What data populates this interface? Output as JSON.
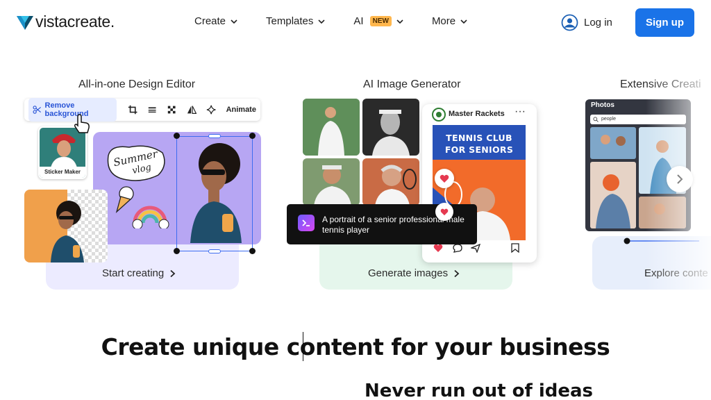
{
  "header": {
    "logo_prefix": "vista",
    "logo_suffix": "create",
    "logo_dot": ".",
    "nav": [
      {
        "label": "Create"
      },
      {
        "label": "Templates"
      },
      {
        "label": "AI",
        "badge": "NEW"
      },
      {
        "label": "More"
      }
    ],
    "login_label": "Log in",
    "signup_label": "Sign up"
  },
  "colors": {
    "accent": "#1a73e8",
    "badge": "#ffb74d",
    "card1_bg": "#ecebff",
    "card2_bg": "#e5f6ec",
    "card3_bg": "#e7eefb"
  },
  "cards": [
    {
      "title": "All-in-one Design Editor",
      "cta": "Start creating",
      "toolbar": {
        "remove_bg": "Remove background",
        "animate": "Animate"
      },
      "sticker_label": "Sticker Maker",
      "sticker_text": "Summer vlog"
    },
    {
      "title": "AI Image Generator",
      "cta": "Generate images",
      "post_account": "Master Rackets",
      "post_title_line1": "TENNIS CLUB",
      "post_title_line2": "FOR SENIORS",
      "prompt": "A portrait of a senior professional male tennis player"
    },
    {
      "title": "Extensive Creati",
      "cta": "Explore conte",
      "panel_title": "Photos",
      "search_value": "people"
    }
  ],
  "headline": "Create unique content for your business",
  "subheadline": "Never run out of ideas"
}
